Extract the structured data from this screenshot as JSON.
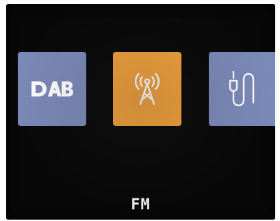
{
  "colors": {
    "screen_bg": "#080808",
    "tile_inactive": "#7b89b8",
    "tile_active": "#f2a13b",
    "icon": "#ffffff"
  },
  "modes": [
    {
      "id": "dab",
      "icon": "dab-logo-icon",
      "logo_text": "DAB",
      "selected": false
    },
    {
      "id": "fm",
      "icon": "radio-tower-icon",
      "selected": true
    },
    {
      "id": "aux",
      "icon": "aux-cable-icon",
      "selected": false
    }
  ],
  "current_mode_label": "FM"
}
